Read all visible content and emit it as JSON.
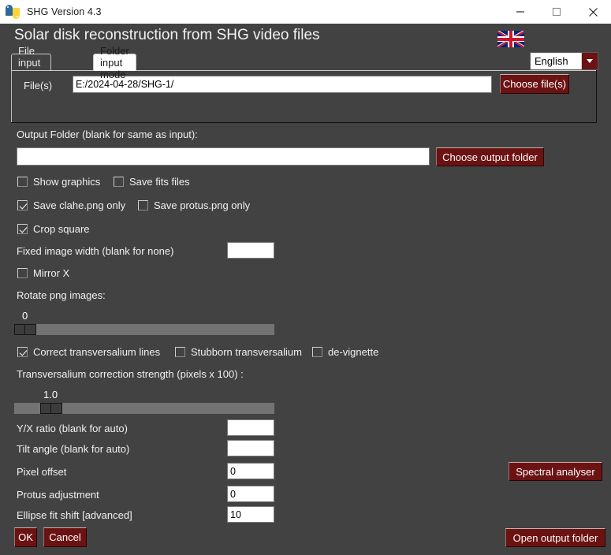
{
  "window": {
    "title": "SHG Version 4.3",
    "icon": "python-logo-icon",
    "minimize": "minimize-button",
    "maximize": "maximize-button",
    "close": "close-button"
  },
  "header": {
    "app_title": "Solar disk reconstruction from SHG video files",
    "flag": "uk-flag-icon",
    "language_value": "English"
  },
  "tabs": [
    {
      "label": "File input mode",
      "active": false
    },
    {
      "label": "Folder input mode",
      "active": true
    }
  ],
  "file_panel": {
    "files_label": "File(s)",
    "files_value": "E:/2024-04-28/SHG-1/",
    "choose_files_label": "Choose file(s)"
  },
  "output": {
    "label": "Output Folder (blank for same as input):",
    "value": "",
    "choose_label": "Choose output folder"
  },
  "checkboxes": [
    {
      "label": "Show graphics",
      "checked": false
    },
    {
      "label": "Save fits files",
      "checked": false
    },
    {
      "label": "Save clahe.png only",
      "checked": true
    },
    {
      "label": "Save protus.png only",
      "checked": false
    },
    {
      "label": "Crop square",
      "checked": true
    },
    {
      "label": "Mirror X",
      "checked": false
    },
    {
      "label": "Correct transversalium lines",
      "checked": true
    },
    {
      "label": "Stubborn transversalium",
      "checked": false
    },
    {
      "label": "de-vignette",
      "checked": false
    }
  ],
  "fields": {
    "fixed_width_label": "Fixed image width (blank for none)",
    "fixed_width_value": "",
    "yx_ratio_label": "Y/X ratio (blank for auto)",
    "yx_ratio_value": "",
    "tilt_angle_label": "Tilt angle (blank for auto)",
    "tilt_angle_value": "",
    "pixel_offset_label": "Pixel offset",
    "pixel_offset_value": "0",
    "protus_adjustment_label": "Protus adjustment",
    "protus_adjustment_value": "0",
    "ellipse_fit_shift_label": "Ellipse fit shift [advanced]",
    "ellipse_fit_shift_value": "10"
  },
  "sliders": {
    "rotate_label": "Rotate png images:",
    "rotate_value": "0",
    "transversalium_label": "Transversalium correction strength (pixels x 100) :",
    "transversalium_value": "1.0"
  },
  "buttons": {
    "spectral_analyser": "Spectral analyser",
    "open_output_folder": "Open output folder",
    "ok": "OK",
    "cancel": "Cancel"
  },
  "colors": {
    "background": "#424242",
    "accent_red": "#6b1212",
    "text": "#f0f0f0",
    "field_bg": "#ffffff"
  }
}
